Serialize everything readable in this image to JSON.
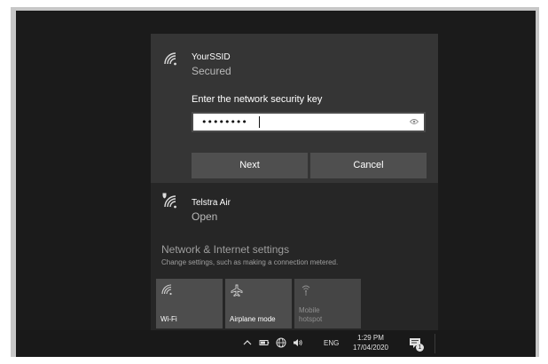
{
  "networks": {
    "selected": {
      "name": "YourSSID",
      "status": "Secured",
      "key_label": "Enter the network security key",
      "key_value": "••••••••",
      "next_label": "Next",
      "cancel_label": "Cancel",
      "icon": "wifi-secured-icon"
    },
    "other": {
      "name": "Telstra Air",
      "status": "Open",
      "icon": "wifi-open-shield-icon"
    }
  },
  "settings": {
    "title": "Network & Internet settings",
    "subtitle": "Change settings, such as making a connection metered."
  },
  "quick_actions": [
    {
      "label": "Wi-Fi",
      "icon": "wifi-icon",
      "enabled": true
    },
    {
      "label": "Airplane mode",
      "icon": "airplane-icon",
      "enabled": true
    },
    {
      "label": "Mobile\nhotspot",
      "icon": "hotspot-icon",
      "enabled": false
    }
  ],
  "taskbar": {
    "language": "ENG",
    "time": "1:29 PM",
    "date": "17/04/2020",
    "notification_count": "1"
  },
  "colors": {
    "background": "#1b1b1b",
    "flyout": "#262626",
    "selected_network": "#353535",
    "button": "#4f4f4f",
    "tile": "#4d4d4d"
  }
}
